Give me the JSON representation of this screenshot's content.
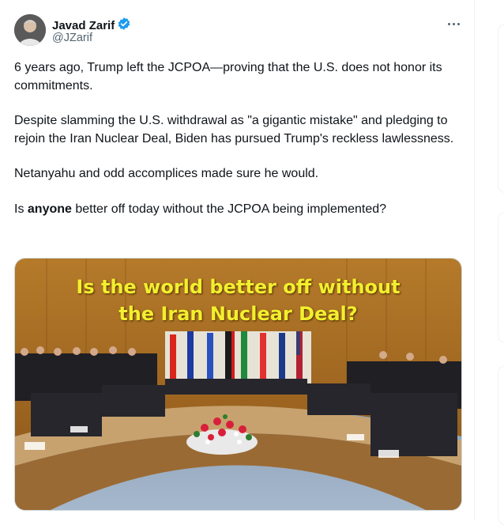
{
  "tweet": {
    "author": {
      "name": "Javad Zarif",
      "handle": "@JZarif",
      "verified": true
    },
    "paragraphs": [
      {
        "text": "6 years ago, Trump left the JCPOA—proving that the U.S. does not honor its commitments."
      },
      {
        "text": "Despite slamming the U.S. withdrawal as \"a gigantic mistake\" and pledging to rejoin the Iran Nuclear Deal, Biden has pursued Trump's reckless lawlessness."
      },
      {
        "text": "Netanyahu and odd accomplices made sure he would."
      },
      {
        "pre": "Is ",
        "bold": "anyone",
        "post": " better off today without the JCPOA being implemented?"
      }
    ],
    "media": {
      "headline_line1": "Is the world better off without",
      "headline_line2": "the Iran Nuclear Deal?"
    }
  },
  "icons": [
    "avatar",
    "verified-badge-icon",
    "more-options-icon"
  ],
  "colors": {
    "verified": "#1d9bf0",
    "headline": "#f2ef2e",
    "secondary_text": "#536471"
  }
}
